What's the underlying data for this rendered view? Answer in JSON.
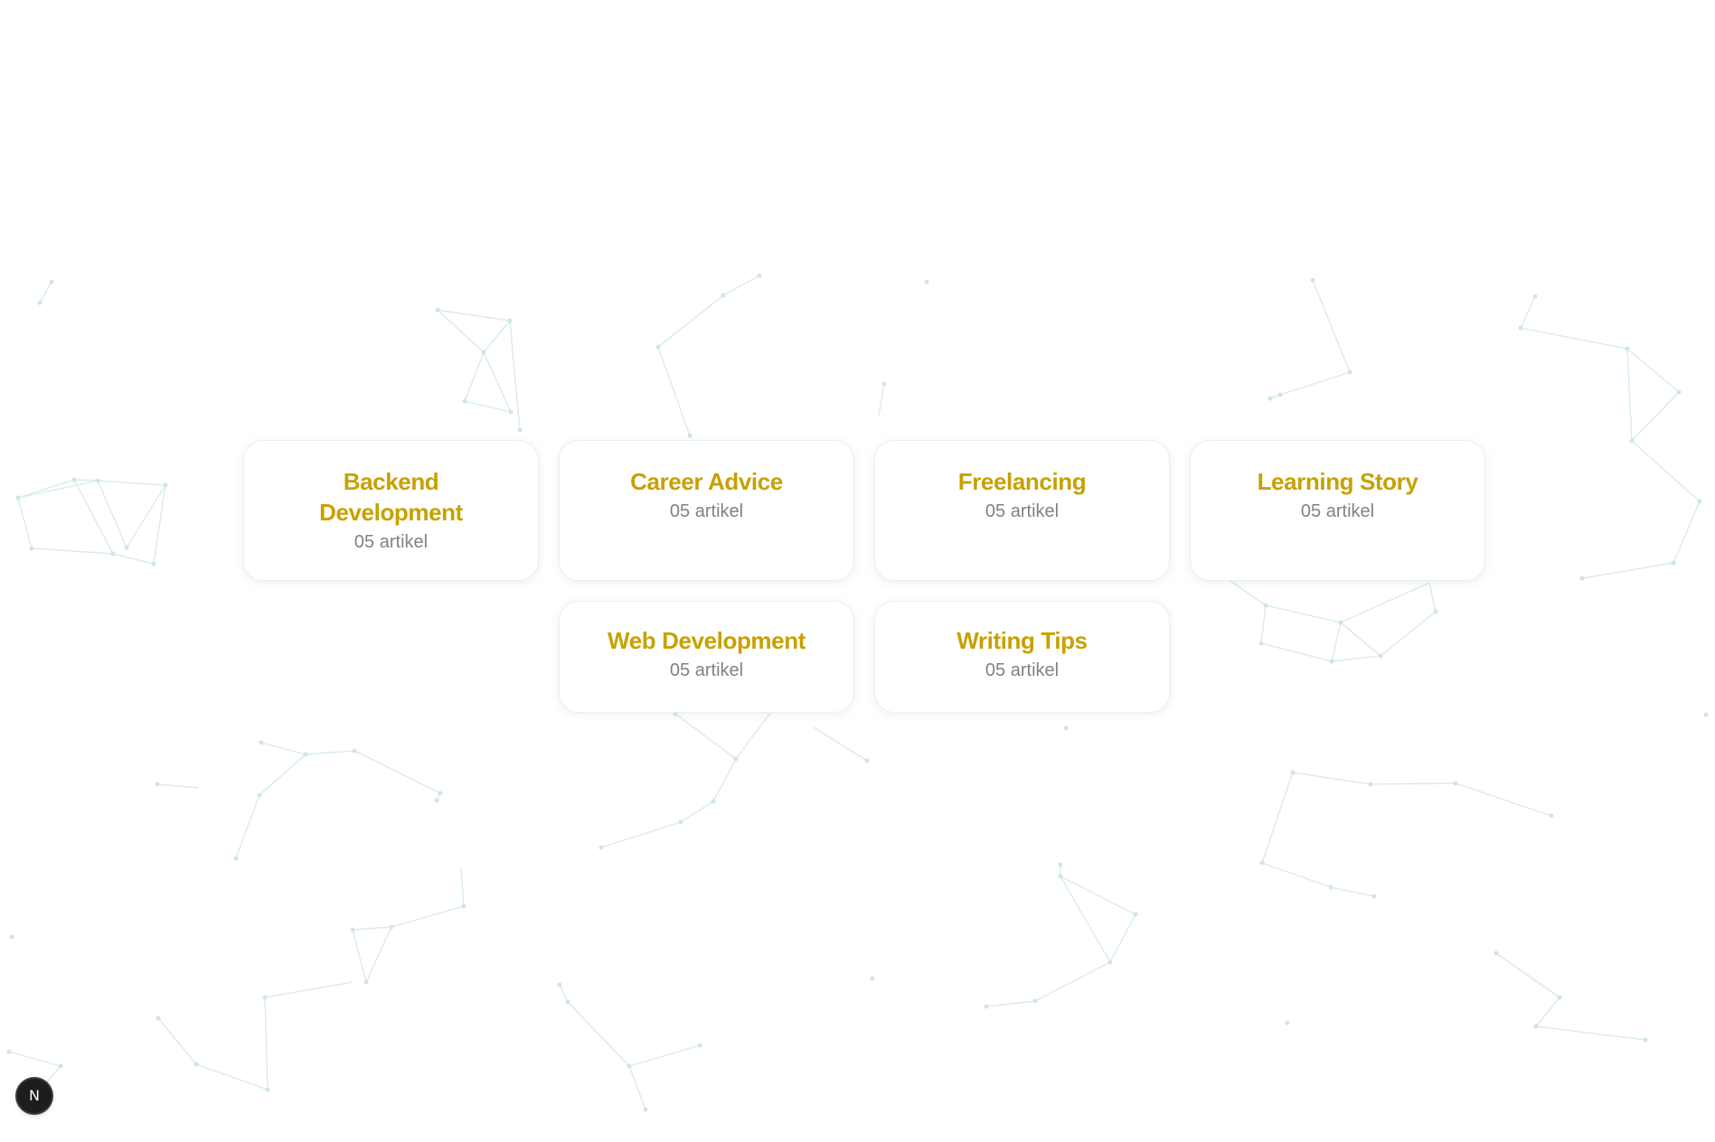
{
  "categories": [
    {
      "title": "Backend Development",
      "count": "05 artikel"
    },
    {
      "title": "Career Advice",
      "count": "05 artikel"
    },
    {
      "title": "Freelancing",
      "count": "05 artikel"
    },
    {
      "title": "Learning Story",
      "count": "05 artikel"
    },
    {
      "title": "Web Development",
      "count": "05 artikel"
    },
    {
      "title": "Writing Tips",
      "count": "05 artikel"
    }
  ],
  "nav_badge": {
    "label": "N",
    "icon": "next-logo-icon"
  },
  "colors": {
    "accent": "#c7a100",
    "muted_text": "#7f8286",
    "background": "#ffffff",
    "network_lines": "#d6ebe9"
  }
}
